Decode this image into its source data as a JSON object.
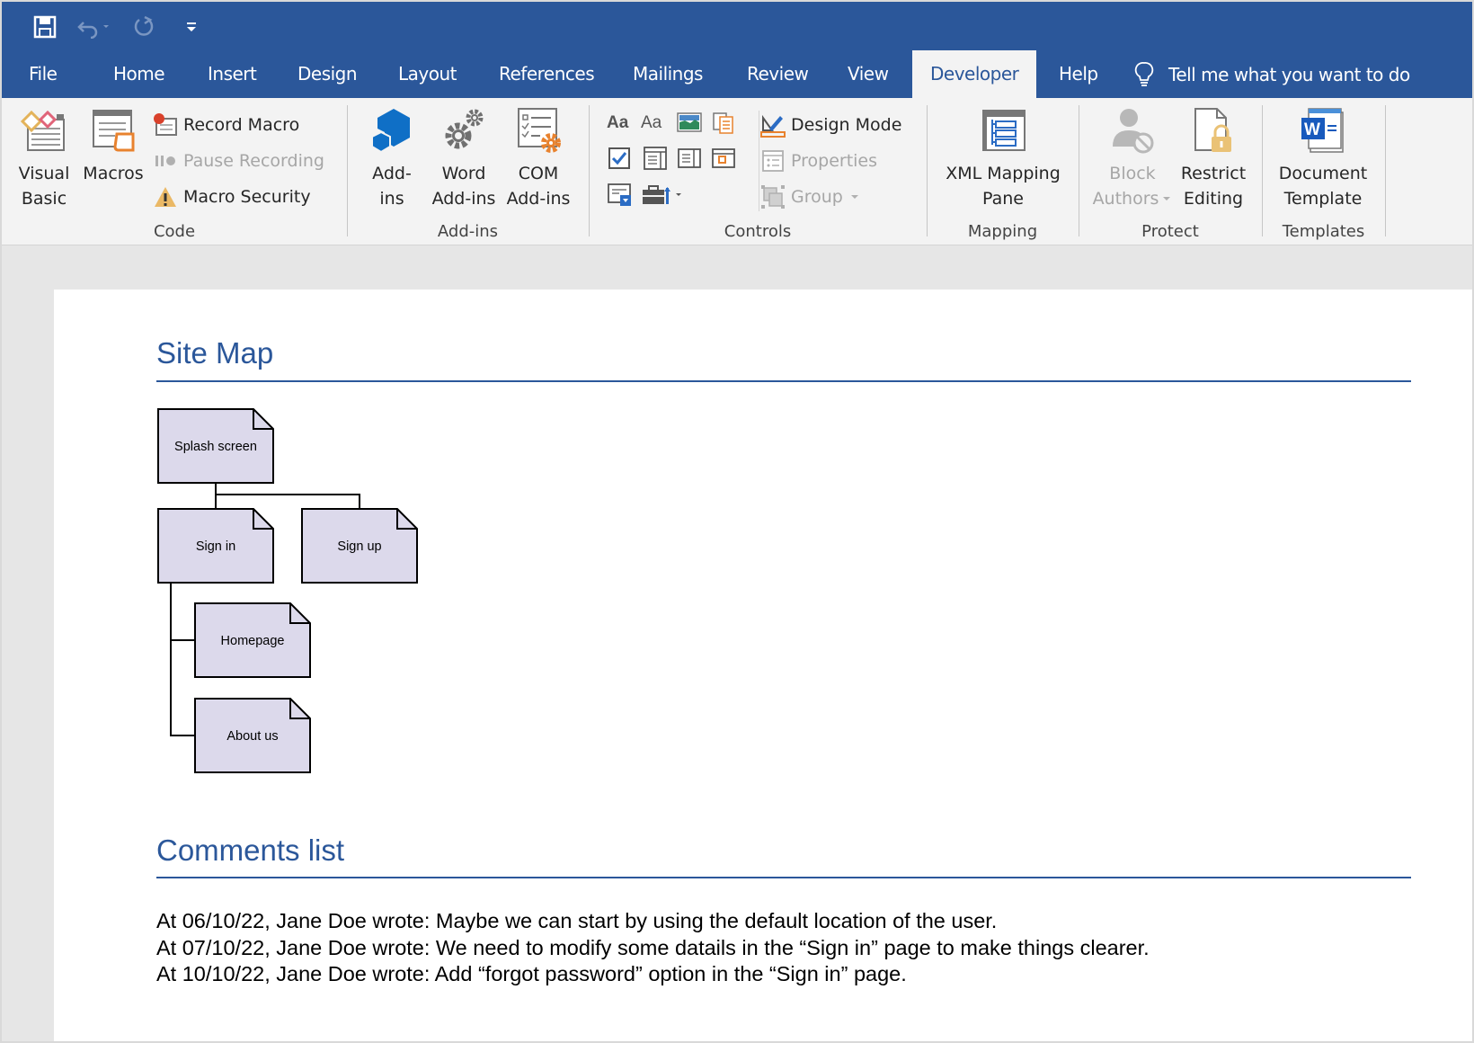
{
  "app": {
    "qat": {
      "save_icon": "save-icon",
      "undo_icon": "undo-icon",
      "redo_icon": "redo-icon",
      "customize_icon": "customize-qat-icon"
    },
    "tabs": [
      {
        "label": "File"
      },
      {
        "label": "Home"
      },
      {
        "label": "Insert"
      },
      {
        "label": "Design"
      },
      {
        "label": "Layout"
      },
      {
        "label": "References"
      },
      {
        "label": "Mailings"
      },
      {
        "label": "Review"
      },
      {
        "label": "View"
      },
      {
        "label": "Developer",
        "active": true
      },
      {
        "label": "Help"
      }
    ],
    "tell_me": "Tell me what you want to do",
    "accent_color": "#2b579a"
  },
  "ribbon": {
    "groups": {
      "code": {
        "label": "Code",
        "visual_basic": [
          "Visual",
          "Basic"
        ],
        "macros": "Macros",
        "record_macro": "Record Macro",
        "pause_recording": "Pause Recording",
        "macro_security": "Macro Security"
      },
      "addins": {
        "label": "Add-ins",
        "addins": [
          "Add-",
          "ins"
        ],
        "word_addins": [
          "Word",
          "Add-ins"
        ],
        "com_addins": [
          "COM",
          "Add-ins"
        ]
      },
      "controls": {
        "label": "Controls",
        "design_mode": "Design Mode",
        "properties": "Properties",
        "group": "Group",
        "control_items": [
          "rich-text-content-control",
          "plain-text-content-control",
          "picture-content-control",
          "building-block-gallery-control",
          "check-box-content-control",
          "combo-box-content-control",
          "drop-down-list-content-control",
          "date-picker-content-control",
          "repeating-section-content-control",
          "legacy-tools"
        ]
      },
      "mapping": {
        "label": "Mapping",
        "xml_mapping_pane": [
          "XML Mapping",
          "Pane"
        ]
      },
      "protect": {
        "label": "Protect",
        "block_authors": [
          "Block",
          "Authors"
        ],
        "restrict_editing": [
          "Restrict",
          "Editing"
        ]
      },
      "templates": {
        "label": "Templates",
        "document_template": [
          "Document",
          "Template"
        ]
      }
    }
  },
  "document": {
    "site_map_heading": "Site Map",
    "site_map": {
      "nodes": [
        {
          "id": "splash",
          "label": "Splash screen"
        },
        {
          "id": "signin",
          "label": "Sign in"
        },
        {
          "id": "signup",
          "label": "Sign up"
        },
        {
          "id": "homepage",
          "label": "Homepage"
        },
        {
          "id": "about",
          "label": "About us"
        }
      ],
      "edges": [
        {
          "from": "splash",
          "to": "signin"
        },
        {
          "from": "splash",
          "to": "signup"
        },
        {
          "from": "signin",
          "to": "homepage"
        },
        {
          "from": "signin",
          "to": "about"
        }
      ],
      "node_fill": "#dcd9eb",
      "node_stroke": "#000000"
    },
    "comments_heading": "Comments list",
    "comments": [
      "At 06/10/22, Jane Doe wrote: Maybe we can start by using the default location of the user.",
      "At 07/10/22, Jane Doe wrote: We need to modify some datails in the “Sign in” page to make things clearer.",
      "At 10/10/22, Jane Doe wrote: Add “forgot password” option in the “Sign in” page."
    ]
  }
}
